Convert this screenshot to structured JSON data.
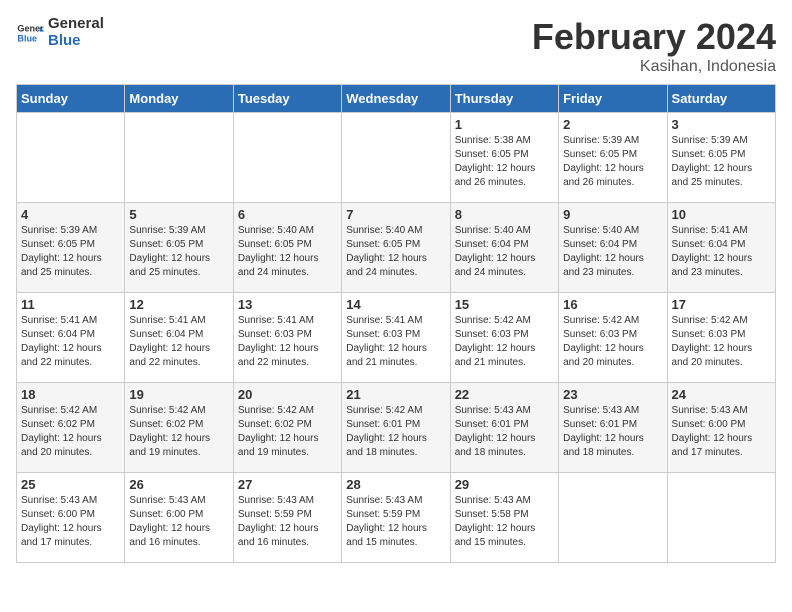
{
  "logo": {
    "line1": "General",
    "line2": "Blue"
  },
  "title": {
    "month_year": "February 2024",
    "location": "Kasihan, Indonesia"
  },
  "weekdays": [
    "Sunday",
    "Monday",
    "Tuesday",
    "Wednesday",
    "Thursday",
    "Friday",
    "Saturday"
  ],
  "weeks": [
    [
      {
        "day": "",
        "info": ""
      },
      {
        "day": "",
        "info": ""
      },
      {
        "day": "",
        "info": ""
      },
      {
        "day": "",
        "info": ""
      },
      {
        "day": "1",
        "info": "Sunrise: 5:38 AM\nSunset: 6:05 PM\nDaylight: 12 hours\nand 26 minutes."
      },
      {
        "day": "2",
        "info": "Sunrise: 5:39 AM\nSunset: 6:05 PM\nDaylight: 12 hours\nand 26 minutes."
      },
      {
        "day": "3",
        "info": "Sunrise: 5:39 AM\nSunset: 6:05 PM\nDaylight: 12 hours\nand 25 minutes."
      }
    ],
    [
      {
        "day": "4",
        "info": "Sunrise: 5:39 AM\nSunset: 6:05 PM\nDaylight: 12 hours\nand 25 minutes."
      },
      {
        "day": "5",
        "info": "Sunrise: 5:39 AM\nSunset: 6:05 PM\nDaylight: 12 hours\nand 25 minutes."
      },
      {
        "day": "6",
        "info": "Sunrise: 5:40 AM\nSunset: 6:05 PM\nDaylight: 12 hours\nand 24 minutes."
      },
      {
        "day": "7",
        "info": "Sunrise: 5:40 AM\nSunset: 6:05 PM\nDaylight: 12 hours\nand 24 minutes."
      },
      {
        "day": "8",
        "info": "Sunrise: 5:40 AM\nSunset: 6:04 PM\nDaylight: 12 hours\nand 24 minutes."
      },
      {
        "day": "9",
        "info": "Sunrise: 5:40 AM\nSunset: 6:04 PM\nDaylight: 12 hours\nand 23 minutes."
      },
      {
        "day": "10",
        "info": "Sunrise: 5:41 AM\nSunset: 6:04 PM\nDaylight: 12 hours\nand 23 minutes."
      }
    ],
    [
      {
        "day": "11",
        "info": "Sunrise: 5:41 AM\nSunset: 6:04 PM\nDaylight: 12 hours\nand 22 minutes."
      },
      {
        "day": "12",
        "info": "Sunrise: 5:41 AM\nSunset: 6:04 PM\nDaylight: 12 hours\nand 22 minutes."
      },
      {
        "day": "13",
        "info": "Sunrise: 5:41 AM\nSunset: 6:03 PM\nDaylight: 12 hours\nand 22 minutes."
      },
      {
        "day": "14",
        "info": "Sunrise: 5:41 AM\nSunset: 6:03 PM\nDaylight: 12 hours\nand 21 minutes."
      },
      {
        "day": "15",
        "info": "Sunrise: 5:42 AM\nSunset: 6:03 PM\nDaylight: 12 hours\nand 21 minutes."
      },
      {
        "day": "16",
        "info": "Sunrise: 5:42 AM\nSunset: 6:03 PM\nDaylight: 12 hours\nand 20 minutes."
      },
      {
        "day": "17",
        "info": "Sunrise: 5:42 AM\nSunset: 6:03 PM\nDaylight: 12 hours\nand 20 minutes."
      }
    ],
    [
      {
        "day": "18",
        "info": "Sunrise: 5:42 AM\nSunset: 6:02 PM\nDaylight: 12 hours\nand 20 minutes."
      },
      {
        "day": "19",
        "info": "Sunrise: 5:42 AM\nSunset: 6:02 PM\nDaylight: 12 hours\nand 19 minutes."
      },
      {
        "day": "20",
        "info": "Sunrise: 5:42 AM\nSunset: 6:02 PM\nDaylight: 12 hours\nand 19 minutes."
      },
      {
        "day": "21",
        "info": "Sunrise: 5:42 AM\nSunset: 6:01 PM\nDaylight: 12 hours\nand 18 minutes."
      },
      {
        "day": "22",
        "info": "Sunrise: 5:43 AM\nSunset: 6:01 PM\nDaylight: 12 hours\nand 18 minutes."
      },
      {
        "day": "23",
        "info": "Sunrise: 5:43 AM\nSunset: 6:01 PM\nDaylight: 12 hours\nand 18 minutes."
      },
      {
        "day": "24",
        "info": "Sunrise: 5:43 AM\nSunset: 6:00 PM\nDaylight: 12 hours\nand 17 minutes."
      }
    ],
    [
      {
        "day": "25",
        "info": "Sunrise: 5:43 AM\nSunset: 6:00 PM\nDaylight: 12 hours\nand 17 minutes."
      },
      {
        "day": "26",
        "info": "Sunrise: 5:43 AM\nSunset: 6:00 PM\nDaylight: 12 hours\nand 16 minutes."
      },
      {
        "day": "27",
        "info": "Sunrise: 5:43 AM\nSunset: 5:59 PM\nDaylight: 12 hours\nand 16 minutes."
      },
      {
        "day": "28",
        "info": "Sunrise: 5:43 AM\nSunset: 5:59 PM\nDaylight: 12 hours\nand 15 minutes."
      },
      {
        "day": "29",
        "info": "Sunrise: 5:43 AM\nSunset: 5:58 PM\nDaylight: 12 hours\nand 15 minutes."
      },
      {
        "day": "",
        "info": ""
      },
      {
        "day": "",
        "info": ""
      }
    ]
  ]
}
